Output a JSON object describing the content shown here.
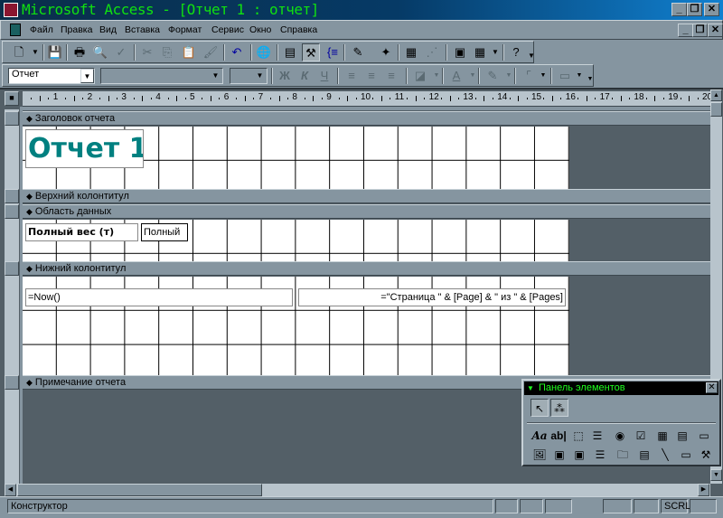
{
  "window": {
    "title": "Microsoft Access - [Отчет 1 : отчет]",
    "controls": [
      "_",
      "❐",
      "✕"
    ]
  },
  "menu": [
    "Файл",
    "Правка",
    "Вид",
    "Вставка",
    "Формат",
    "Сервис",
    "Окно",
    "Справка"
  ],
  "toolbar1": [
    "view-icon",
    "save-icon",
    "print-icon",
    "preview-icon",
    "spelling-icon",
    "cut-icon",
    "copy-icon",
    "paste-icon",
    "format-painter-icon",
    "undo-icon",
    "hyperlink-icon",
    "field-list-icon",
    "toolbox-icon",
    "sorting-icon",
    "autoformat-icon",
    "code-icon",
    "properties-icon",
    "build-icon",
    "database-window-icon",
    "new-object-icon",
    "help-icon"
  ],
  "toolbar2": {
    "object": "Отчет",
    "font": "",
    "size": "",
    "bold": "Ж",
    "italic": "К",
    "underline": "Ч"
  },
  "ruler": [
    "1",
    "2",
    "3",
    "4",
    "5",
    "6",
    "7",
    "8",
    "9",
    "10",
    "11",
    "12",
    "13",
    "14",
    "15",
    "16",
    "17",
    "18",
    "19",
    "20"
  ],
  "sections": {
    "report_header": "Заголовок отчета",
    "page_header": "Верхний колонтитул",
    "detail": "Область данных",
    "page_footer": "Нижний колонтитул",
    "report_footer": "Примечание отчета"
  },
  "controls": {
    "title": "Отчет 1",
    "label": "Полный вес (т)",
    "field": "Полный",
    "now": "=Now()",
    "page": "=\"Страница \" & [Page] & \" из \" & [Pages]"
  },
  "toolbox": {
    "title": "Панель элементов"
  },
  "status": {
    "mode": "Конструктор",
    "scrl": "SCRL"
  },
  "colors": {
    "title_text": "#10e010",
    "report_title": "#008080",
    "chrome": "#8595a0",
    "dark": "#535f67"
  }
}
